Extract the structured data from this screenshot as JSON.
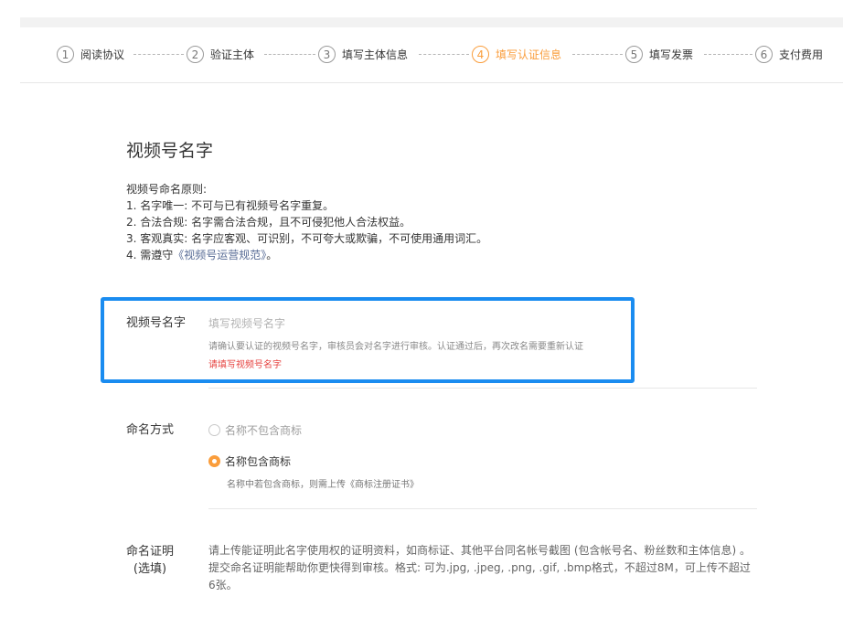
{
  "steps": [
    {
      "num": "1",
      "label": "阅读协议"
    },
    {
      "num": "2",
      "label": "验证主体"
    },
    {
      "num": "3",
      "label": "填写主体信息"
    },
    {
      "num": "4",
      "label": "填写认证信息"
    },
    {
      "num": "5",
      "label": "填写发票"
    },
    {
      "num": "6",
      "label": "支付费用"
    }
  ],
  "active_step": "4",
  "section": {
    "title": "视频号名字",
    "rules_heading": "视频号命名原则:",
    "rules": [
      "1. 名字唯一: 不可与已有视频号名字重复。",
      "2. 合法合规: 名字需合法合规，且不可侵犯他人合法权益。",
      "3. 客观真实: 名字应客观、可识别，不可夸大或欺骗，不可使用通用词汇。"
    ],
    "rule4_prefix": "4. 需遵守",
    "rule4_link": "《视频号运营规范》",
    "rule4_suffix": "。"
  },
  "name_field": {
    "label": "视频号名字",
    "placeholder": "填写视频号名字",
    "value": "",
    "hint": "请确认要认证的视频号名字，审核员会对名字进行审核。认证通过后，再次改名需要重新认证",
    "error": "请填写视频号名字"
  },
  "naming_method": {
    "label": "命名方式",
    "options": [
      {
        "label": "名称不包含商标",
        "selected": false
      },
      {
        "label": "名称包含商标",
        "selected": true
      }
    ],
    "note": "名称中若包含商标，则需上传《商标注册证书》"
  },
  "proof": {
    "label_line1": "命名证明",
    "label_line2": "(选填)",
    "description": "请上传能证明此名字使用权的证明资料，如商标证、其他平台同名帐号截图 (包含帐号名、粉丝数和主体信息) 。提交命名证明能帮助你更快得到审核。格式: 可为.jpg, .jpeg, .png, .gif, .bmp格式，不超过8M，可上传不超过6张。"
  },
  "colors": {
    "accent": "#fa9d3b",
    "highlight_border": "#1a8cf0",
    "error": "#e64340",
    "link": "#576b95"
  }
}
